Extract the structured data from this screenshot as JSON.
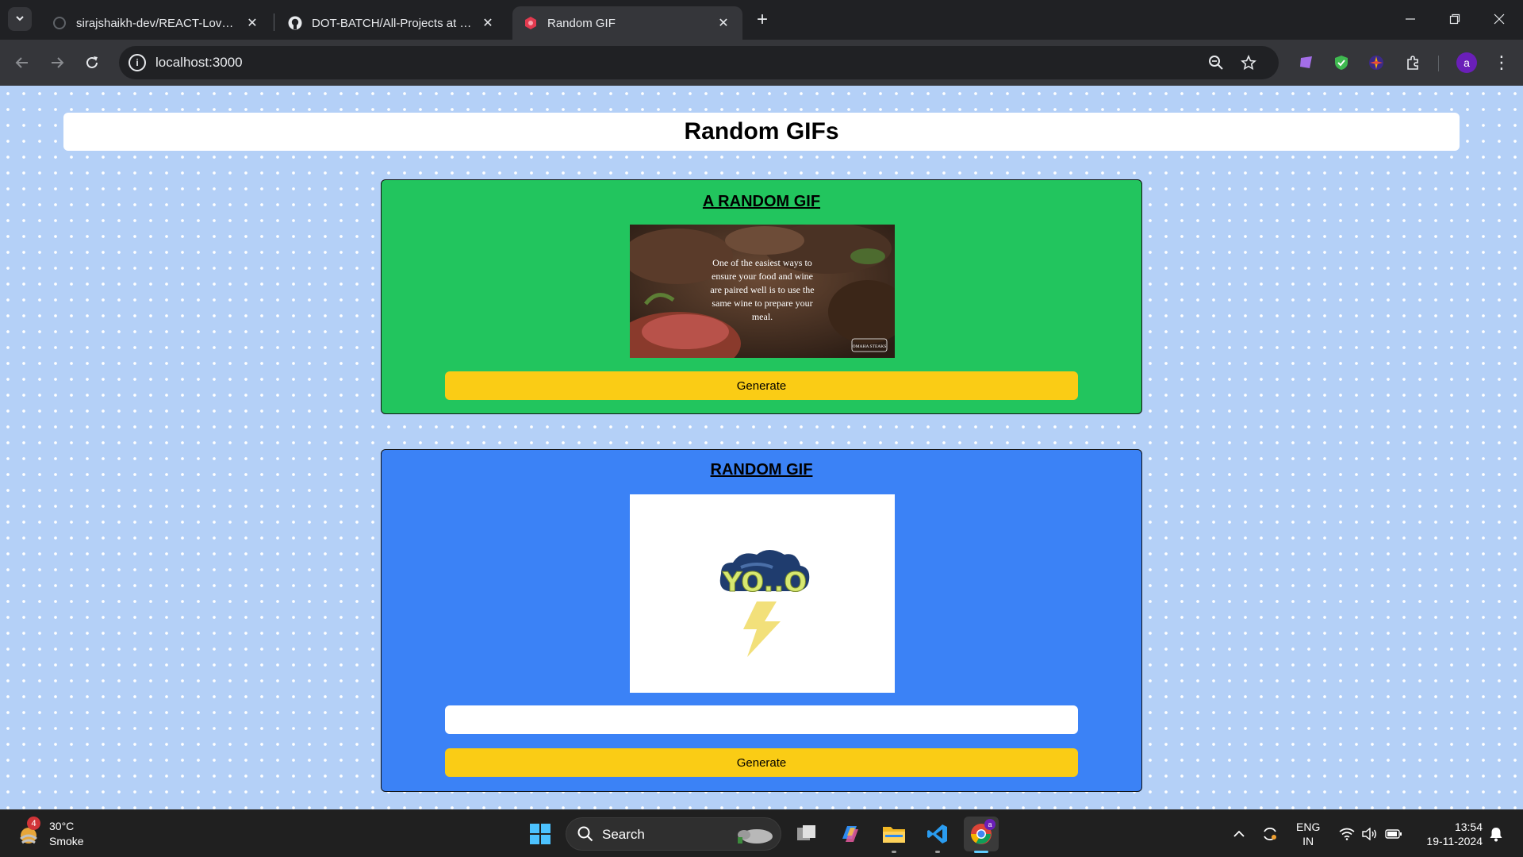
{
  "browser": {
    "tabs": [
      {
        "title": "sirajshaikh-dev/REACT-Love-Babbar",
        "active": false
      },
      {
        "title": "DOT-BATCH/All-Projects at master",
        "active": false
      },
      {
        "title": "Random GIF",
        "active": true
      }
    ],
    "url": "localhost:3000",
    "profile_initial": "a"
  },
  "page": {
    "header_title": "Random GIFs",
    "random_card": {
      "title": "A RANDOM GIF",
      "gif_caption": "One of the easiest ways to ensure your food and wine are paired well is to use the same wine to prepare your meal.",
      "gif_watermark": "OMAHA STEAKS",
      "button_label": "Generate",
      "bg_color": "#22c55e"
    },
    "tag_card": {
      "title": "RANDOM GIF",
      "gif_text": "YO..O",
      "input_value": "",
      "button_label": "Generate",
      "bg_color": "#3b82f6"
    }
  },
  "taskbar": {
    "weather": {
      "temp": "30°C",
      "condition": "Smoke",
      "badge": "4"
    },
    "search_label": "Search",
    "language": {
      "line1": "ENG",
      "line2": "IN"
    },
    "clock": {
      "time": "13:54",
      "date": "19-11-2024"
    },
    "chrome_badge": "a"
  },
  "colors": {
    "page_bg": "#b4d0f7",
    "button_yellow": "#facc15",
    "chrome_dark": "#202124"
  }
}
